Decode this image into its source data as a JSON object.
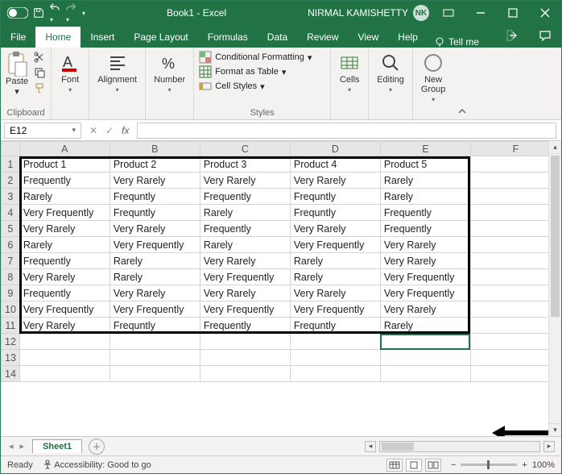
{
  "titlebar": {
    "autosave_label": "AutoSave",
    "doc_title": "Book1 - Excel",
    "user_name": "NIRMAL KAMISHETTY",
    "user_initials": "NK"
  },
  "tabs": {
    "file": "File",
    "home": "Home",
    "insert": "Insert",
    "page_layout": "Page Layout",
    "formulas": "Formulas",
    "data": "Data",
    "review": "Review",
    "view": "View",
    "help": "Help",
    "tell_me": "Tell me"
  },
  "ribbon": {
    "clipboard": {
      "paste": "Paste",
      "group": "Clipboard"
    },
    "font": {
      "btn": "Font",
      "group": ""
    },
    "alignment": {
      "btn": "Alignment",
      "group": ""
    },
    "number": {
      "btn": "Number",
      "group": ""
    },
    "styles": {
      "cond": "Conditional Formatting",
      "table": "Format as Table",
      "cell": "Cell Styles",
      "group": "Styles"
    },
    "cells": {
      "btn": "Cells",
      "group": ""
    },
    "editing": {
      "btn": "Editing",
      "group": ""
    },
    "newgroup": {
      "btn": "New\nGroup",
      "group": ""
    }
  },
  "formula_bar": {
    "name_box": "E12",
    "formula": ""
  },
  "columns": [
    "A",
    "B",
    "C",
    "D",
    "E",
    "F"
  ],
  "row_headers": [
    "1",
    "2",
    "3",
    "4",
    "5",
    "6",
    "7",
    "8",
    "9",
    "10",
    "11",
    "12",
    "13",
    "14"
  ],
  "grid": [
    [
      "Product 1",
      "Product 2",
      "Product 3",
      "Product 4",
      "Product 5",
      ""
    ],
    [
      "Frequently",
      "Very Rarely",
      "Very Rarely",
      "Very Rarely",
      "Rarely",
      ""
    ],
    [
      "Rarely",
      "Frequntly",
      "Frequently",
      "Frequntly",
      "Rarely",
      ""
    ],
    [
      "Very Frequently",
      "Frequntly",
      "Rarely",
      "Frequntly",
      "Frequently",
      ""
    ],
    [
      "Very Rarely",
      "Very Rarely",
      "Frequently",
      "Very Rarely",
      "Frequently",
      ""
    ],
    [
      "Rarely",
      "Very Frequently",
      "Rarely",
      "Very Frequently",
      "Very Rarely",
      ""
    ],
    [
      "Frequently",
      "Rarely",
      "Very Rarely",
      "Rarely",
      "Very Rarely",
      ""
    ],
    [
      "Very Rarely",
      "Rarely",
      "Very Frequently",
      "Rarely",
      "Very Frequently",
      ""
    ],
    [
      "Frequently",
      "Very Rarely",
      "Very Rarely",
      "Very Rarely",
      "Very Frequently",
      ""
    ],
    [
      "Very Frequently",
      "Very Frequently",
      "Very Frequently",
      "Very Frequently",
      "Very Rarely",
      ""
    ],
    [
      "Very Rarely",
      "Frequntly",
      "Frequently",
      "Frequntly",
      "Rarely",
      ""
    ],
    [
      "",
      "",
      "",
      "",
      "",
      ""
    ],
    [
      "",
      "",
      "",
      "",
      "",
      ""
    ],
    [
      "",
      "",
      "",
      "",
      "",
      ""
    ]
  ],
  "selection": {
    "cell": "E12",
    "row": 12,
    "col": 5
  },
  "sheet_tabs": {
    "sheet1": "Sheet1"
  },
  "statusbar": {
    "ready": "Ready",
    "accessibility": "Accessibility: Good to go",
    "zoom": "100%"
  }
}
